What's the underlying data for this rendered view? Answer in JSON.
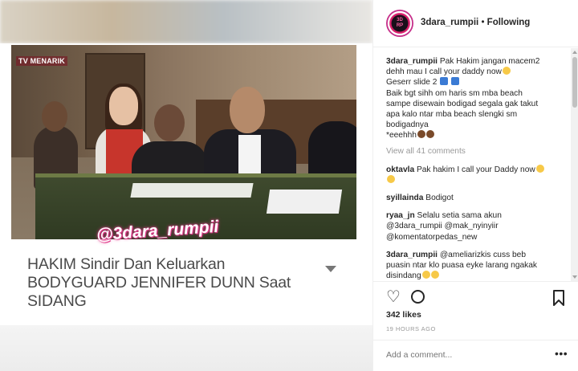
{
  "media": {
    "tv_logo": "TV MENARIK",
    "watermark": "@3dara_rumpii",
    "caption_line1": "HAKIM Sindir Dan Keluarkan",
    "caption_line2": "BODYGUARD JENNIFER DUNN Saat",
    "caption_line3": "SIDANG"
  },
  "header": {
    "username": "3dara_rumpii",
    "separator": "•",
    "follow_status": "Following"
  },
  "post": {
    "author": "3dara_rumpii",
    "caption_lines": [
      "Pak Hakim jangan macem2",
      "dehh mau I call your daddy now",
      "Geserr slide 2",
      "Baik bgt sihh om haris sm mba beach",
      "sampe disewain bodigad segala gak takut",
      "apa kalo ntar mba beach slengki sm",
      "bodigadnya",
      "*eeehhh"
    ],
    "view_all": "View all 41 comments"
  },
  "comments": [
    {
      "user": "oktavla",
      "lines": [
        "Pak hakim I call your Daddy now"
      ]
    },
    {
      "user": "syillainda",
      "lines": [
        "Bodigot"
      ]
    },
    {
      "user": "ryaa_jn",
      "lines": [
        "Selalu setia sama akun",
        "@3dara_rumpii @mak_nyinyiir",
        "@komentatorpedas_new"
      ]
    },
    {
      "user": "3dara_rumpii",
      "lines": [
        "@ameliarizkis cuss beb",
        "puasin ntar klo puasa eyke larang ngakak",
        "disindang"
      ]
    }
  ],
  "stats": {
    "likes": "342 likes",
    "time": "19 HOURS AGO"
  },
  "add_comment": {
    "placeholder": "Add a comment...",
    "more_label": "•••"
  },
  "icons": [
    "heart-icon",
    "comment-icon",
    "bookmark-icon",
    "avatar"
  ],
  "colors": {
    "watermark_glow": "#e23c8c",
    "muted": "#999999",
    "text": "#262626"
  }
}
